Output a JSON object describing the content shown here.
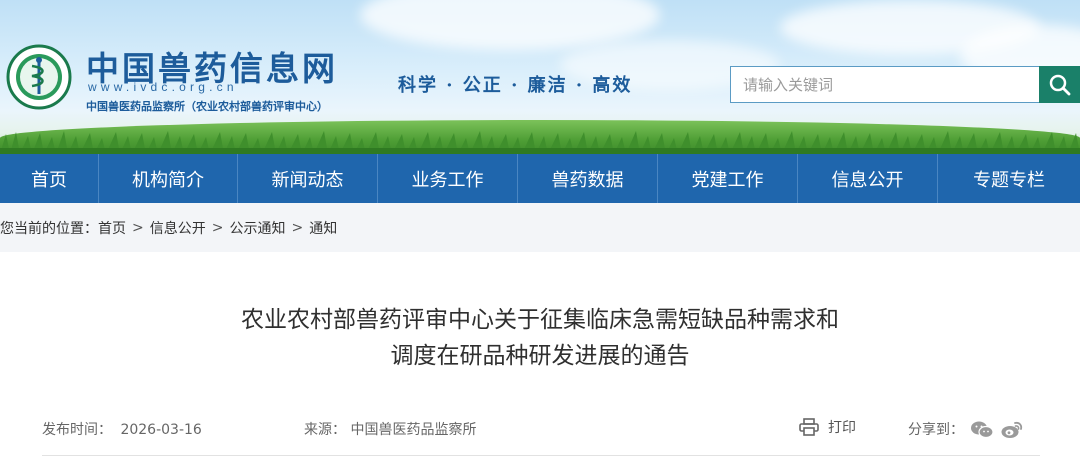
{
  "header": {
    "site_name": "中国兽药信息网",
    "domain": "www.ivdc.org.cn",
    "org": "中国兽医药品监察所（农业农村部兽药评审中心）",
    "slogan": "科学 · 公正 · 廉洁 · 高效",
    "search_placeholder": "请输入关键词",
    "search_icon": "search-icon",
    "logo_icon": "emblem-icon"
  },
  "nav": {
    "items": [
      "首页",
      "机构简介",
      "新闻动态",
      "业务工作",
      "兽药数据",
      "党建工作",
      "信息公开",
      "专题专栏"
    ]
  },
  "breadcrumb": {
    "label": "您当前的位置：",
    "items": [
      "首页",
      "信息公开",
      "公示通知",
      "通知"
    ],
    "separator": ">"
  },
  "article": {
    "title_line1": "农业农村部兽药评审中心关于征集临床急需短缺品种需求和",
    "title_line2": "调度在研品种研发进展的通告",
    "publish_label": "发布时间：",
    "publish_date": "2026-03-16",
    "source_label": "来源：",
    "source": "中国兽医药品监察所",
    "print_label": "打印",
    "share_label": "分享到：",
    "share_icons": [
      "wechat-icon",
      "weibo-icon"
    ]
  },
  "colors": {
    "nav_bg": "#1f66ad",
    "brand_blue": "#1d5c9b",
    "search_button": "#1a8069"
  }
}
